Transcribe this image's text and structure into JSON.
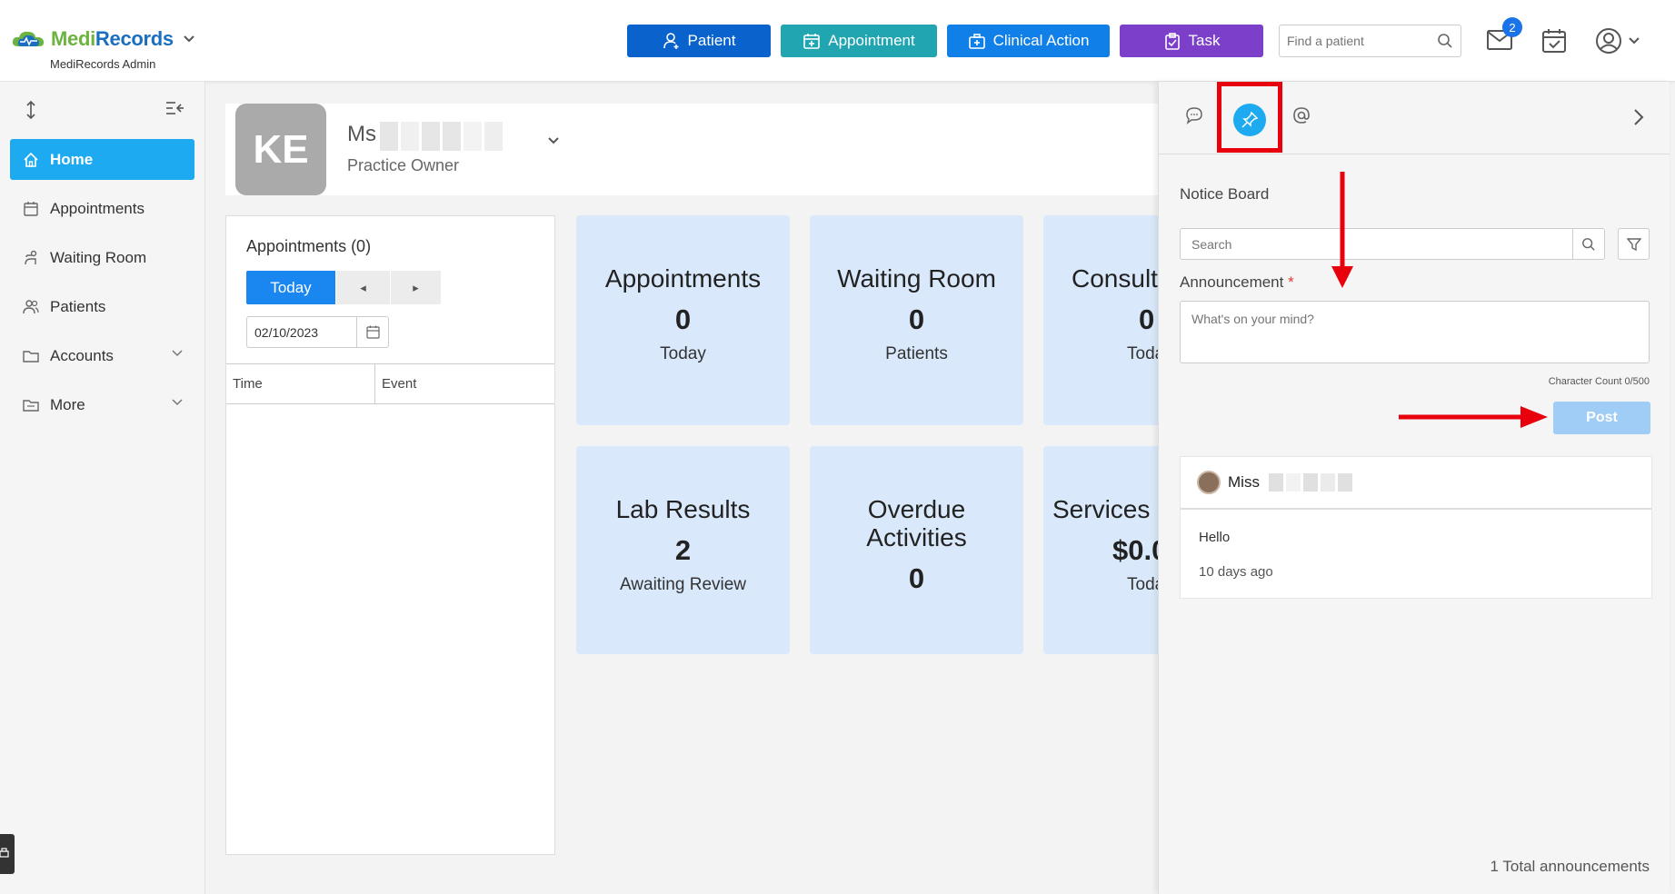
{
  "header": {
    "brand_medi": "Medi",
    "brand_records": "Records",
    "brand_sub": "MediRecords Admin",
    "buttons": {
      "patient": "Patient",
      "appointment": "Appointment",
      "clinical": "Clinical Action",
      "task": "Task"
    },
    "search_placeholder": "Find a patient",
    "mail_badge": "2"
  },
  "sidebar": {
    "items": [
      {
        "label": "Home",
        "icon": "home-icon",
        "active": true
      },
      {
        "label": "Appointments",
        "icon": "calendar-icon"
      },
      {
        "label": "Waiting Room",
        "icon": "waiting-room-icon"
      },
      {
        "label": "Patients",
        "icon": "patients-icon"
      },
      {
        "label": "Accounts",
        "icon": "folder-icon",
        "expandable": true
      },
      {
        "label": "More",
        "icon": "folder-icon",
        "expandable": true
      }
    ]
  },
  "profile": {
    "initials": "KE",
    "title": "Ms",
    "role": "Practice Owner"
  },
  "appointments_panel": {
    "title": "Appointments (0)",
    "today_label": "Today",
    "prev_label": "◂",
    "next_label": "▸",
    "date_value": "02/10/2023",
    "columns": [
      "Time",
      "Event"
    ]
  },
  "cards": [
    {
      "title": "Appointments",
      "value": "0",
      "sub": "Today"
    },
    {
      "title": "Waiting Room",
      "value": "0",
      "sub": "Patients"
    },
    {
      "title": "Consult",
      "value": "0",
      "sub": "Toda"
    },
    {
      "title": "Lab Results",
      "value": "2",
      "sub": "Awaiting Review"
    },
    {
      "title": "Overdue Activities",
      "value": "0",
      "sub": ""
    },
    {
      "title": "Services I",
      "value": "$0.0",
      "sub": "Toda"
    }
  ],
  "notice_board": {
    "title": "Notice Board",
    "search_placeholder": "Search",
    "announcement_label": "Announcement",
    "required_mark": "*",
    "textarea_placeholder": "What's on your mind?",
    "char_count": "Character Count 0/500",
    "post_label": "Post",
    "post": {
      "author": "Miss",
      "body": "Hello",
      "time": "10 days ago"
    },
    "total": "1 Total announcements"
  },
  "colors": {
    "patient_btn": "#0a63cc",
    "appointment_btn": "#21a5b1",
    "clinical_btn": "#1080e8",
    "task_btn": "#7b3fc9",
    "nav_active": "#1eaaf1",
    "card_bg": "#d9e9fb",
    "annotation_red": "#e8000d"
  }
}
